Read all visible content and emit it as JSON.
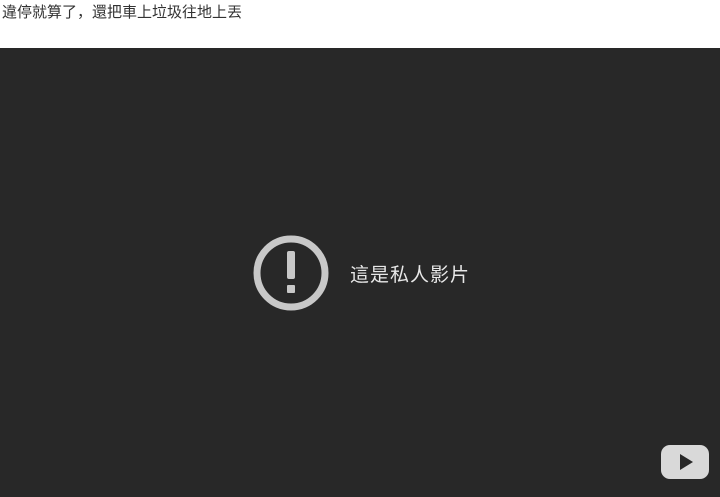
{
  "headline": {
    "text": "違停就算了，還把車上垃圾往地上丟"
  },
  "player": {
    "error_message": "這是私人影片",
    "error_icon": "alert-circle-icon",
    "logo_icon": "youtube-logo-icon",
    "background_color": "#282828",
    "icon_color": "#c8c8c8"
  }
}
